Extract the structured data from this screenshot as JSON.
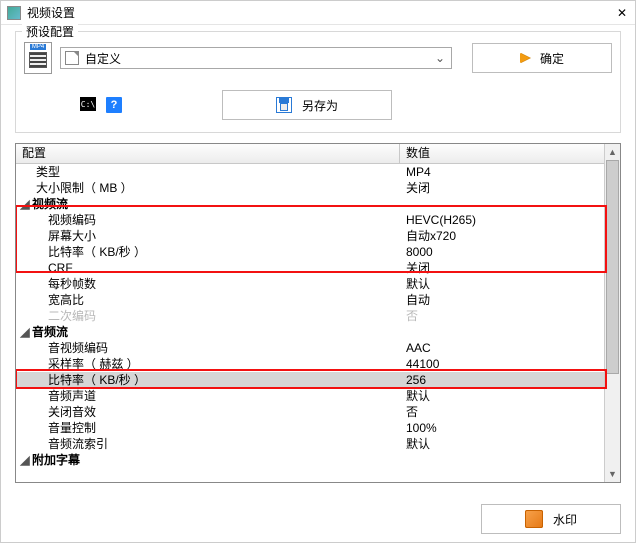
{
  "title": "视频设置",
  "preset": {
    "legend": "预设配置",
    "combo_value": "自定义",
    "ok_label": "确定",
    "saveas_label": "另存为"
  },
  "grid": {
    "header_key": "配置",
    "header_val": "数值",
    "rows": [
      {
        "k": "类型",
        "v": "MP4",
        "type": "item"
      },
      {
        "k": "大小限制（ MB ）",
        "v": "关闭",
        "type": "item"
      },
      {
        "k": "视频流",
        "v": "",
        "type": "section"
      },
      {
        "k": "视频编码",
        "v": "HEVC(H265)",
        "type": "item",
        "indent": 2
      },
      {
        "k": "屏幕大小",
        "v": "自动x720",
        "type": "item",
        "indent": 2
      },
      {
        "k": "比特率（ KB/秒 ）",
        "v": "8000",
        "type": "item",
        "indent": 2
      },
      {
        "k": "CRF",
        "v": "关闭",
        "type": "item",
        "indent": 2
      },
      {
        "k": "每秒帧数",
        "v": "默认",
        "type": "item",
        "indent": 2
      },
      {
        "k": "宽高比",
        "v": "自动",
        "type": "item",
        "indent": 2
      },
      {
        "k": "二次编码",
        "v": "否",
        "type": "item",
        "indent": 2,
        "disabled": true
      },
      {
        "k": "音频流",
        "v": "",
        "type": "section"
      },
      {
        "k": "音视频编码",
        "v": "AAC",
        "type": "item",
        "indent": 2
      },
      {
        "k": "采样率（ 赫兹 ）",
        "v": "44100",
        "type": "item",
        "indent": 2
      },
      {
        "k": "比特率（ KB/秒 ）",
        "v": "256",
        "type": "item",
        "indent": 2,
        "selected": true
      },
      {
        "k": "音频声道",
        "v": "默认",
        "type": "item",
        "indent": 2
      },
      {
        "k": "关闭音效",
        "v": "否",
        "type": "item",
        "indent": 2
      },
      {
        "k": "音量控制",
        "v": "100%",
        "type": "item",
        "indent": 2
      },
      {
        "k": "音频流索引",
        "v": "默认",
        "type": "item",
        "indent": 2
      },
      {
        "k": "附加字幕",
        "v": "",
        "type": "section"
      }
    ]
  },
  "footer": {
    "watermark_label": "水印"
  }
}
